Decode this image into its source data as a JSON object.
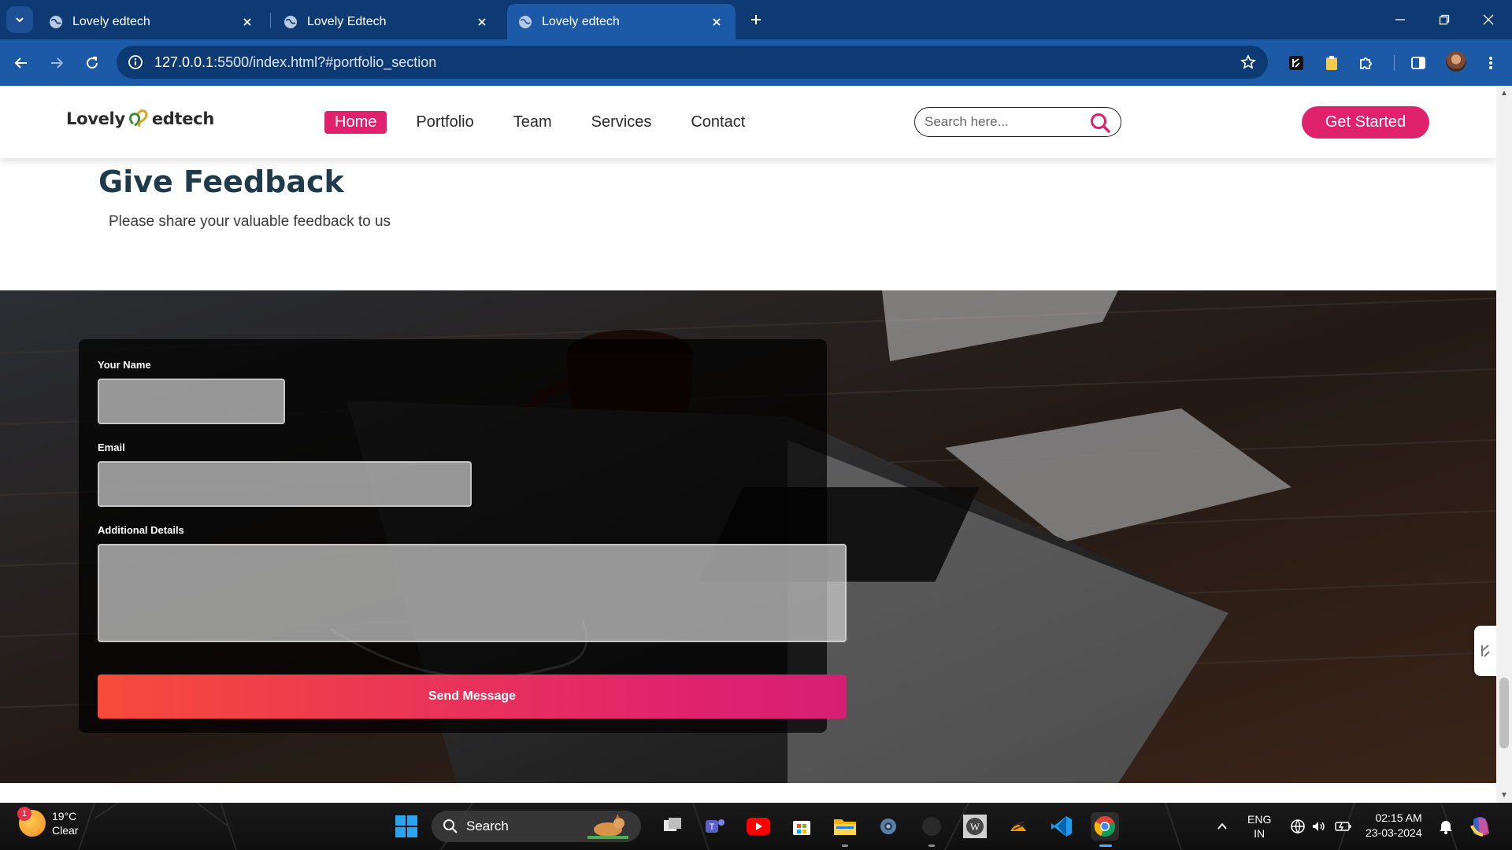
{
  "browser": {
    "tabs": [
      {
        "title": "Lovely edtech",
        "active": false
      },
      {
        "title": "Lovely Edtech",
        "active": false
      },
      {
        "title": "Lovely edtech",
        "active": true
      }
    ],
    "address": {
      "host": "127.0.0.1",
      "rest": ":5500/index.html?#portfolio_section"
    }
  },
  "site": {
    "logo": {
      "left": "Lovely",
      "right": "edtech"
    },
    "nav": [
      "Home",
      "Portfolio",
      "Team",
      "Services",
      "Contact"
    ],
    "active_nav": "Home",
    "search_placeholder": "Search here...",
    "cta_label": "Get Started",
    "accent_color": "#e0226e"
  },
  "feedback": {
    "title": "Give Feedback",
    "subtitle": "Please share your valuable feedback to us",
    "form": {
      "name_label": "Your Name",
      "email_label": "Email",
      "details_label": "Additional Details",
      "submit_label": "Send Message"
    }
  },
  "taskbar": {
    "weather": {
      "temp": "19°C",
      "condition": "Clear",
      "badge": "1"
    },
    "search_label": "Search",
    "apps": [
      "windows-start",
      "widget-app",
      "task-view",
      "teams",
      "youtube",
      "microsoft-store",
      "file-explorer",
      "settings",
      "dark-app",
      "wordpress",
      "sublime-text",
      "vs-code",
      "chrome"
    ],
    "tray": {
      "lang_top": "ENG",
      "lang_bottom": "IN"
    },
    "clock": {
      "time": "02:15 AM",
      "date": "23-03-2024"
    }
  }
}
